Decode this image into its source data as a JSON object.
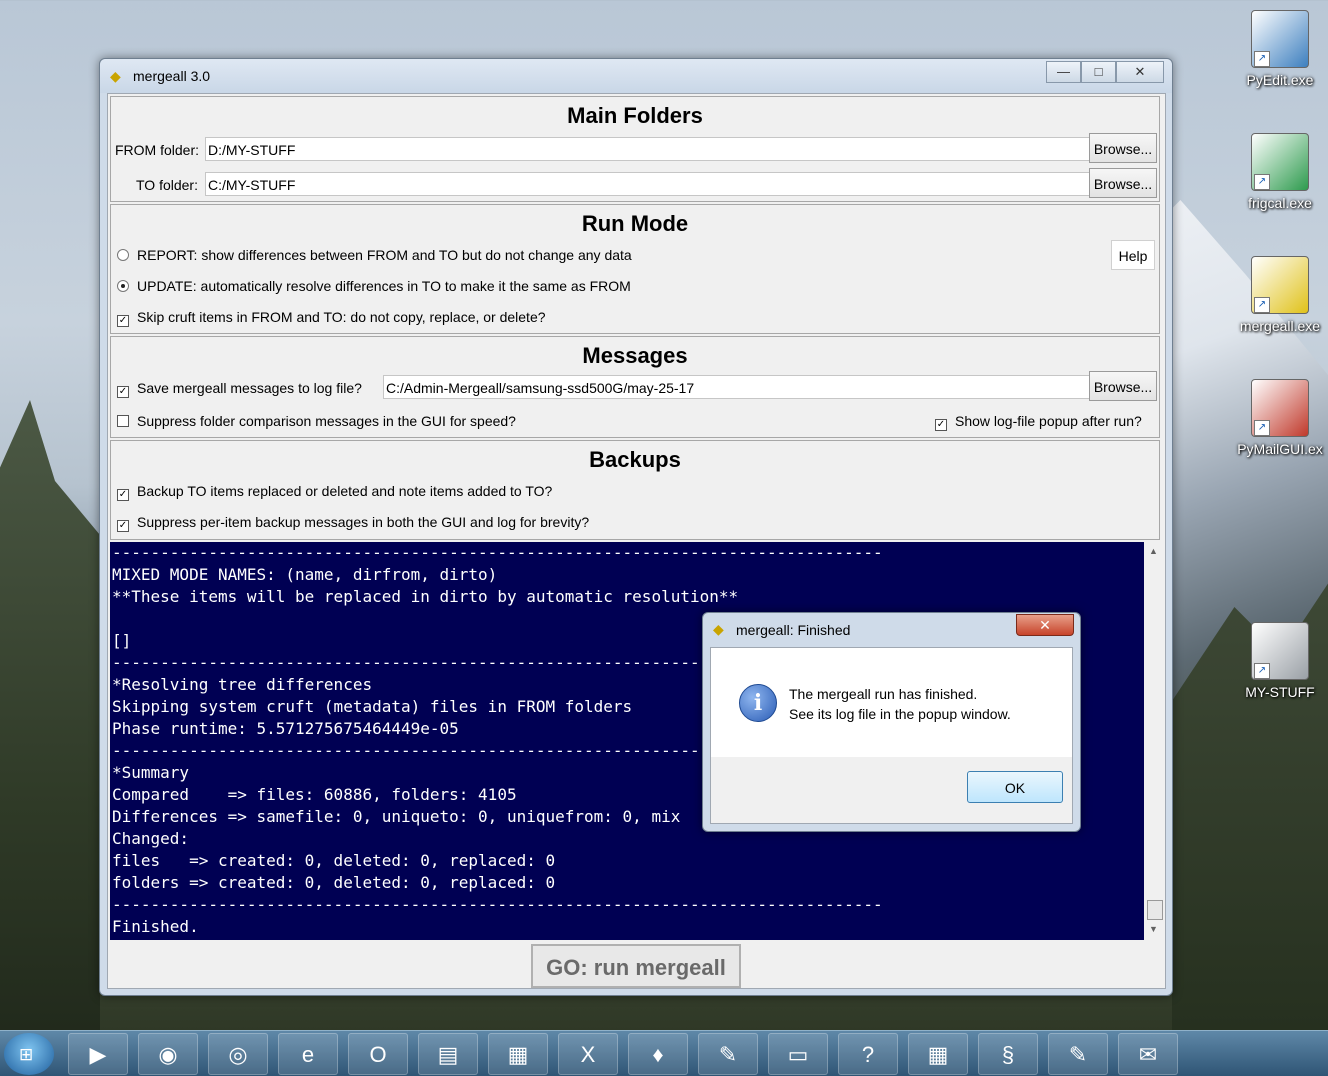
{
  "window": {
    "title": "mergeall 3.0",
    "minimize_glyph": "—",
    "maximize_glyph": "□",
    "close_glyph": "✕"
  },
  "main_folders": {
    "heading": "Main Folders",
    "from_label": "FROM folder:",
    "from_value": "D:/MY-STUFF",
    "to_label": "TO folder:",
    "to_value": "C:/MY-STUFF",
    "browse_label": "Browse..."
  },
  "run_mode": {
    "heading": "Run Mode",
    "report_label": "REPORT: show differences between FROM and TO but do not change any data",
    "report_selected": false,
    "update_label": "UPDATE: automatically resolve differences in TO to make it the same as FROM",
    "update_selected": true,
    "skip_label": "Skip cruft items in FROM and TO: do not copy, replace, or delete?",
    "skip_checked": true,
    "help_label": "Help"
  },
  "messages": {
    "heading": "Messages",
    "save_label": "Save mergeall messages to log file?",
    "save_checked": true,
    "log_path": "C:/Admin-Mergeall/samsung-ssd500G/may-25-17",
    "browse_label": "Browse...",
    "suppress_label": "Suppress folder comparison messages in the GUI for speed?",
    "suppress_checked": false,
    "popup_label": "Show log-file popup after run?",
    "popup_checked": true
  },
  "backups": {
    "heading": "Backups",
    "backup_label": "Backup TO items replaced or deleted and note items added to TO?",
    "backup_checked": true,
    "suppress_label": "Suppress per-item backup messages in both the GUI and log for brevity?",
    "suppress_checked": true
  },
  "console_lines": [
    "--------------------------------------------------------------------------------",
    "MIXED MODE NAMES: (name, dirfrom, dirto)",
    "**These items will be replaced in dirto by automatic resolution**",
    "",
    "[]",
    "--------------------------------------------------------------------------------",
    "*Resolving tree differences",
    "Skipping system cruft (metadata) files in FROM folders",
    "Phase runtime: 5.571275675464449e-05",
    "--------------------------------------------------------------------------------",
    "*Summary",
    "Compared    => files: 60886, folders: 4105",
    "Differences => samefile: 0, uniqueto: 0, uniquefrom: 0, mix",
    "Changed:",
    "files   => created: 0, deleted: 0, replaced: 0",
    "folders => created: 0, deleted: 0, replaced: 0",
    "--------------------------------------------------------------------------------",
    "Finished."
  ],
  "go_button": "GO: run mergeall",
  "dialog": {
    "title": "mergeall: Finished",
    "close_glyph": "✕",
    "icon_glyph": "i",
    "line1": "The mergeall run has finished.",
    "line2": "See its log file in the popup window.",
    "ok_label": "OK"
  },
  "desktop_icons": [
    {
      "label": "PyEdit.exe",
      "icon": "notepad-icon"
    },
    {
      "label": "frigcal.exe",
      "icon": "calendar-icon"
    },
    {
      "label": "mergeall.exe",
      "icon": "mergeall-icon"
    },
    {
      "label": "PyMailGUI.ex",
      "icon": "mailbox-icon"
    },
    {
      "label": "MY-STUFF",
      "icon": "drive-icon"
    }
  ],
  "taskbar": {
    "start_glyph": "⊞",
    "items": [
      {
        "name": "media-player-icon",
        "glyph": "▶"
      },
      {
        "name": "firefox-icon",
        "glyph": "◉"
      },
      {
        "name": "chrome-icon",
        "glyph": "◎"
      },
      {
        "name": "ie-icon",
        "glyph": "e"
      },
      {
        "name": "opera-icon",
        "glyph": "O"
      },
      {
        "name": "explorer-icon",
        "glyph": "▤"
      },
      {
        "name": "archive-icon",
        "glyph": "▦"
      },
      {
        "name": "excel-icon",
        "glyph": "X"
      },
      {
        "name": "python-icon",
        "glyph": "♦"
      },
      {
        "name": "notepad-icon",
        "glyph": "✎"
      },
      {
        "name": "terminal-icon",
        "glyph": "▭"
      },
      {
        "name": "help-icon",
        "glyph": "?"
      },
      {
        "name": "calendar-icon",
        "glyph": "▦"
      },
      {
        "name": "mergeall-icon",
        "glyph": "§"
      },
      {
        "name": "pyedit-icon",
        "glyph": "✎"
      },
      {
        "name": "mailbox-icon",
        "glyph": "✉"
      }
    ]
  }
}
